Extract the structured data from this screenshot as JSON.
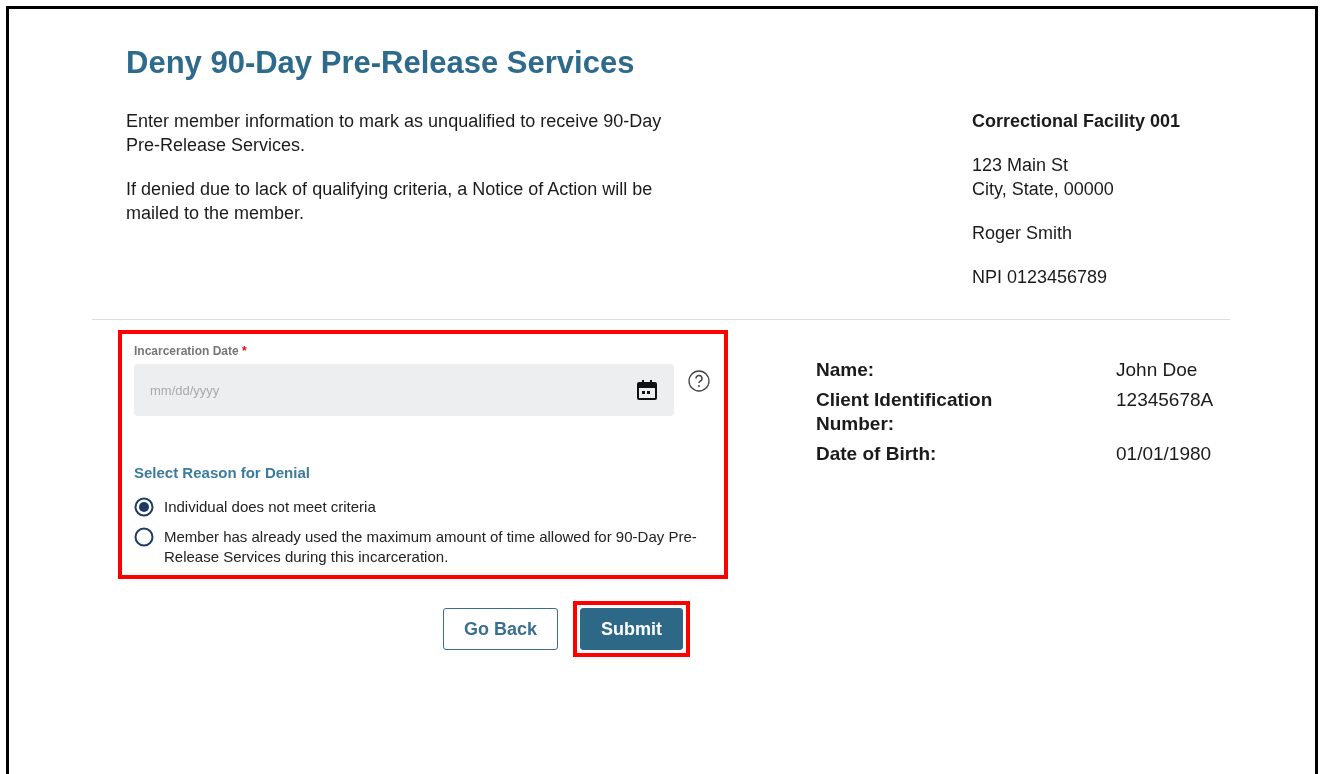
{
  "title": "Deny 90-Day Pre-Release Services",
  "intro": [
    "Enter member information to mark as unqualified to receive 90-Day Pre-Release Services.",
    "If denied due to lack of qualifying criteria, a Notice of Action will be mailed to the member."
  ],
  "facility": {
    "name": "Correctional Facility 001",
    "address": [
      "123 Main St",
      "City, State, 00000"
    ],
    "contact": "Roger Smith",
    "npi": "NPI 0123456789"
  },
  "form": {
    "highlighted": true,
    "date_label": "Incarceration Date",
    "required_mark": "*",
    "date_placeholder": "mm/dd/yyyy",
    "reason_heading": "Select Reason for Denial",
    "reasons": [
      {
        "label": "Individual does not meet criteria",
        "selected": true
      },
      {
        "label": "Member has already used the maximum amount of time allowed for 90-Day Pre-Release Services during this incarceration.",
        "selected": false
      }
    ]
  },
  "member": [
    {
      "label": "Name:",
      "value": "John Doe"
    },
    {
      "label": "Client Identification Number:",
      "value": "12345678A"
    },
    {
      "label": "Date of Birth:",
      "value": "01/01/1980"
    }
  ],
  "buttons": [
    {
      "label": "Go Back",
      "kind": "secondary",
      "highlighted": false
    },
    {
      "label": "Submit",
      "kind": "primary",
      "highlighted": true
    }
  ]
}
